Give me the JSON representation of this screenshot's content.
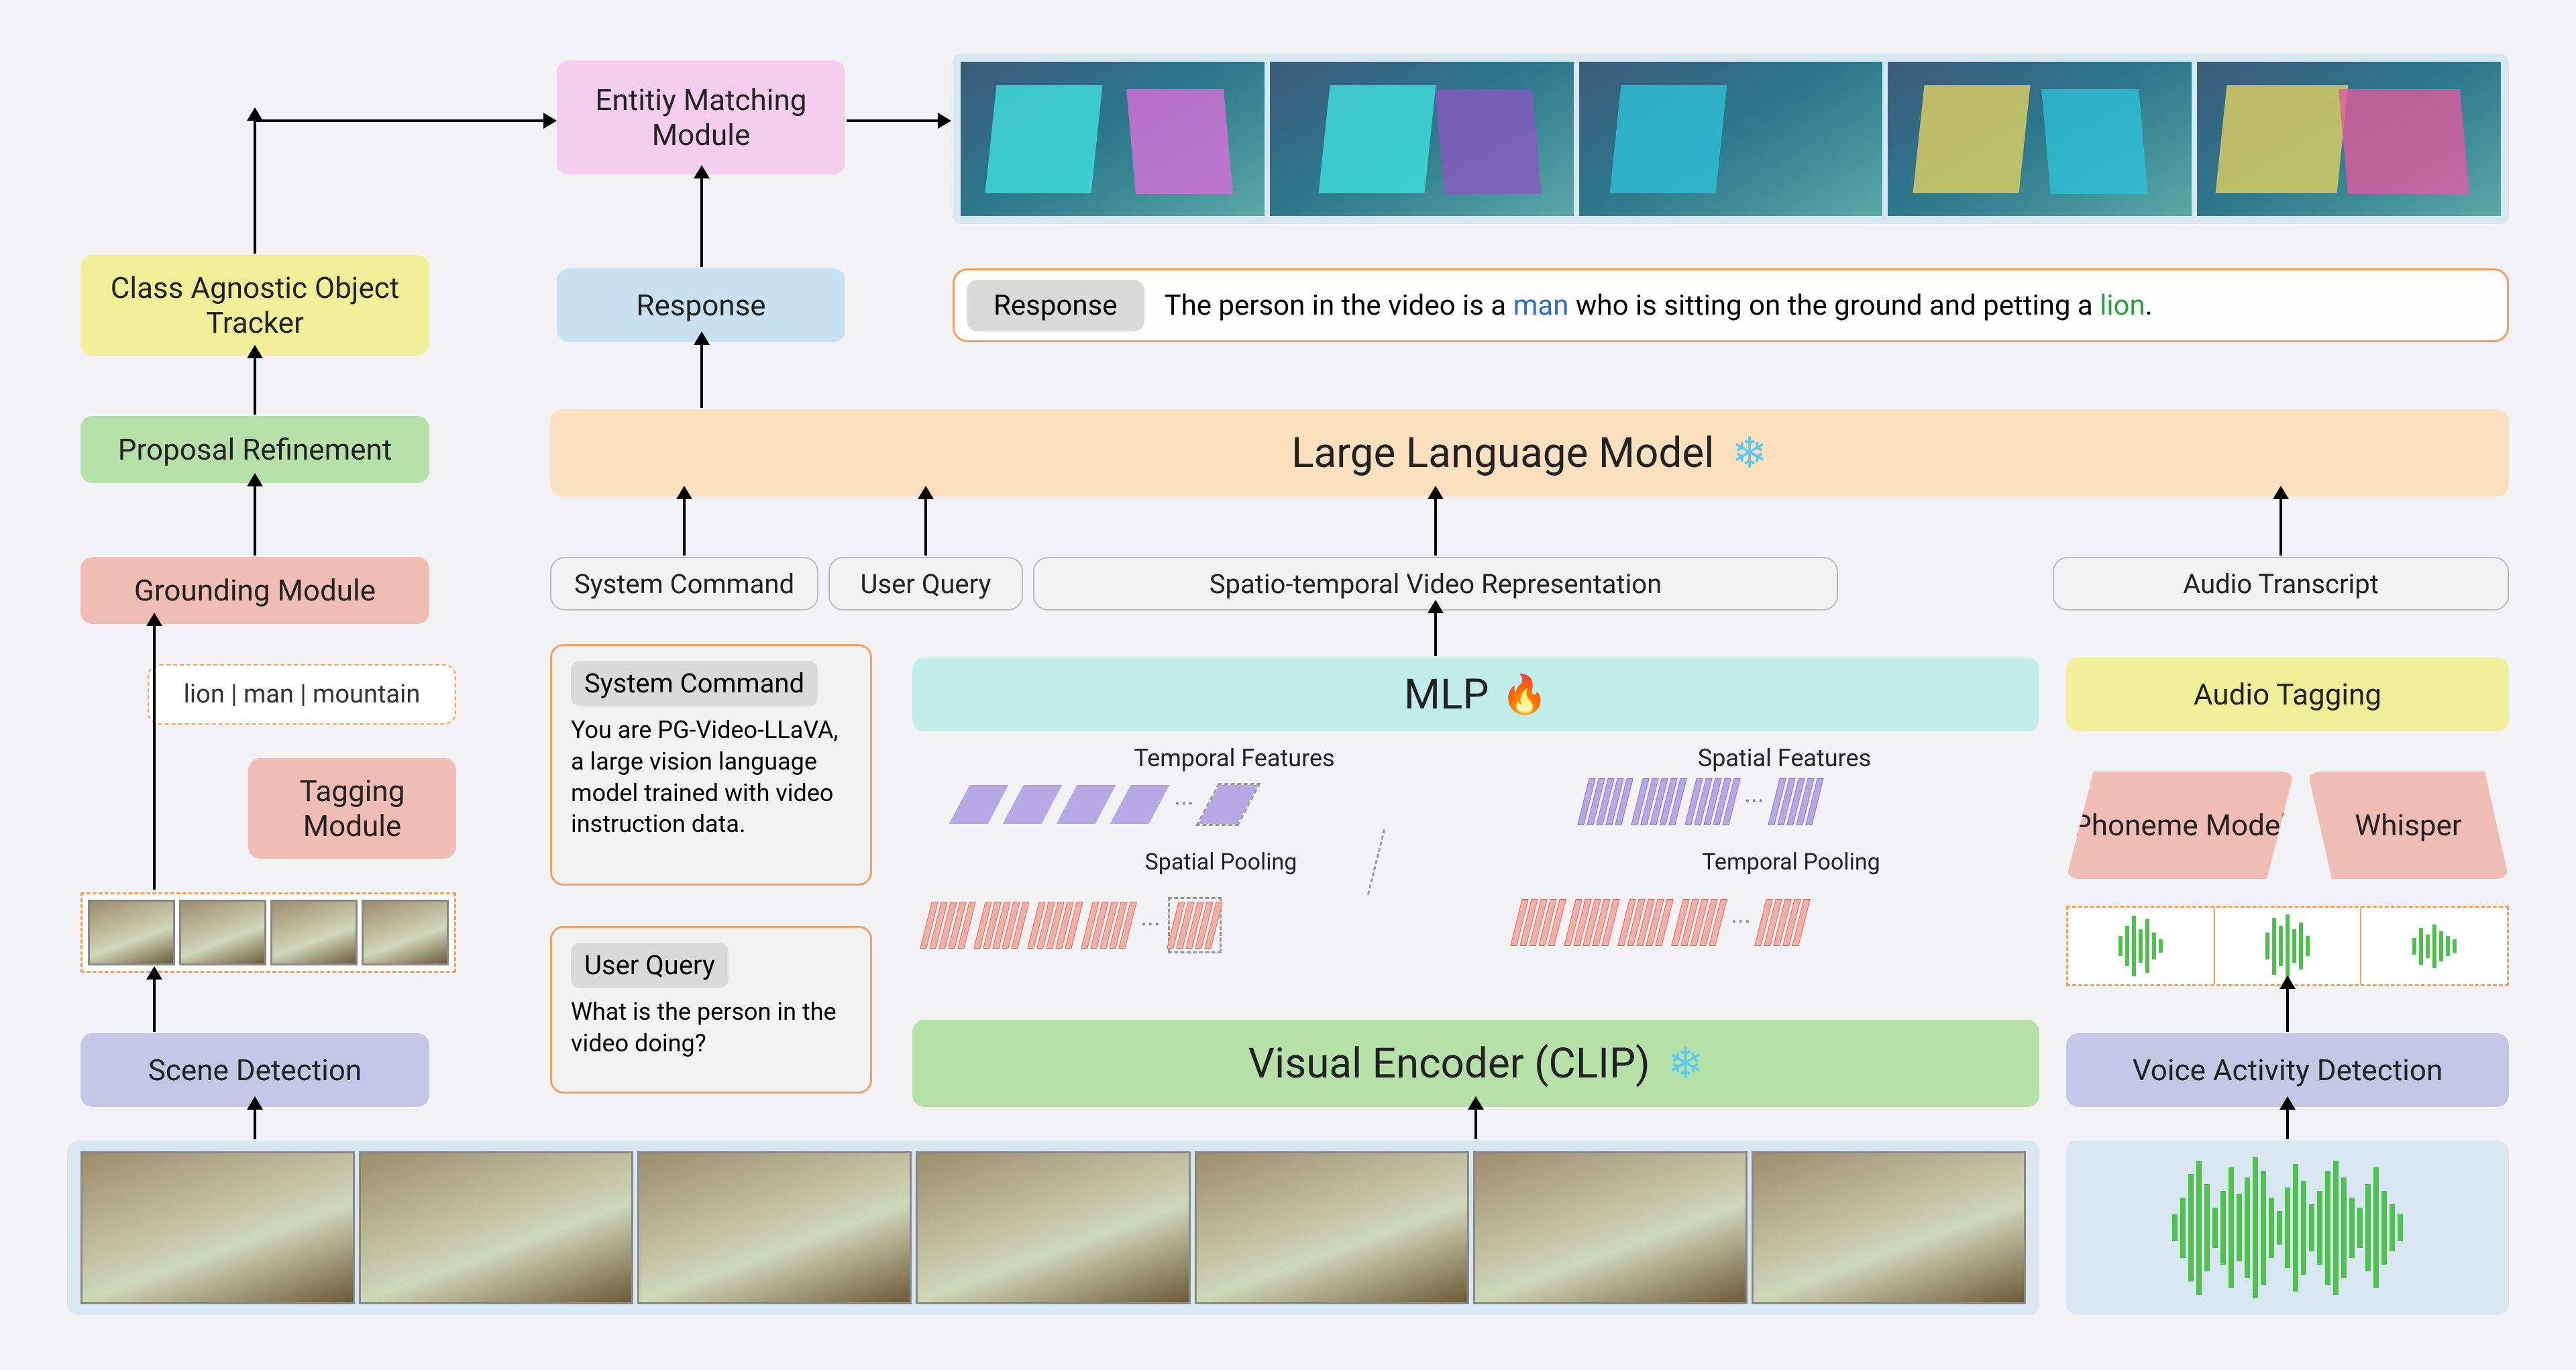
{
  "modules": {
    "scene_detection": "Scene Detection",
    "tagging": "Tagging Module",
    "grounding": "Grounding Module",
    "proposal": "Proposal Refinement",
    "tracker": "Class Agnostic Object Tracker",
    "entity_match": "Entitiy Matching Module",
    "response_box": "Response",
    "llm": "Large Language Model",
    "mlp": "MLP",
    "visual_encoder": "Visual Encoder (CLIP)",
    "audio_tagging": "Audio Tagging",
    "phoneme": "Phoneme Model",
    "whisper": "Whisper",
    "vad": "Voice Activity Detection"
  },
  "tags_example": "lion | man | mountain",
  "pills": {
    "system_command": "System Command",
    "user_query": "User Query",
    "video_repr": "Spatio-temporal Video Representation",
    "audio_transcript": "Audio Transcript"
  },
  "prompts": {
    "system_command_title": "System Command",
    "system_command_body": "You are PG-Video-LLaVA, a large vision language model trained with video instruction data.",
    "user_query_title": "User Query",
    "user_query_body": "What is the person in the video doing?"
  },
  "feature_labels": {
    "temporal_features": "Temporal Features",
    "spatial_features": "Spatial Features",
    "spatial_pooling": "Spatial Pooling",
    "temporal_pooling": "Temporal Pooling"
  },
  "response": {
    "label": "Response",
    "prefix": "The person in the video is a ",
    "entity1": "man",
    "mid": " who is sitting on the ground and petting a ",
    "entity2": "lion",
    "suffix": "."
  },
  "icons": {
    "frozen": "snowflake",
    "trainable": "fire"
  }
}
